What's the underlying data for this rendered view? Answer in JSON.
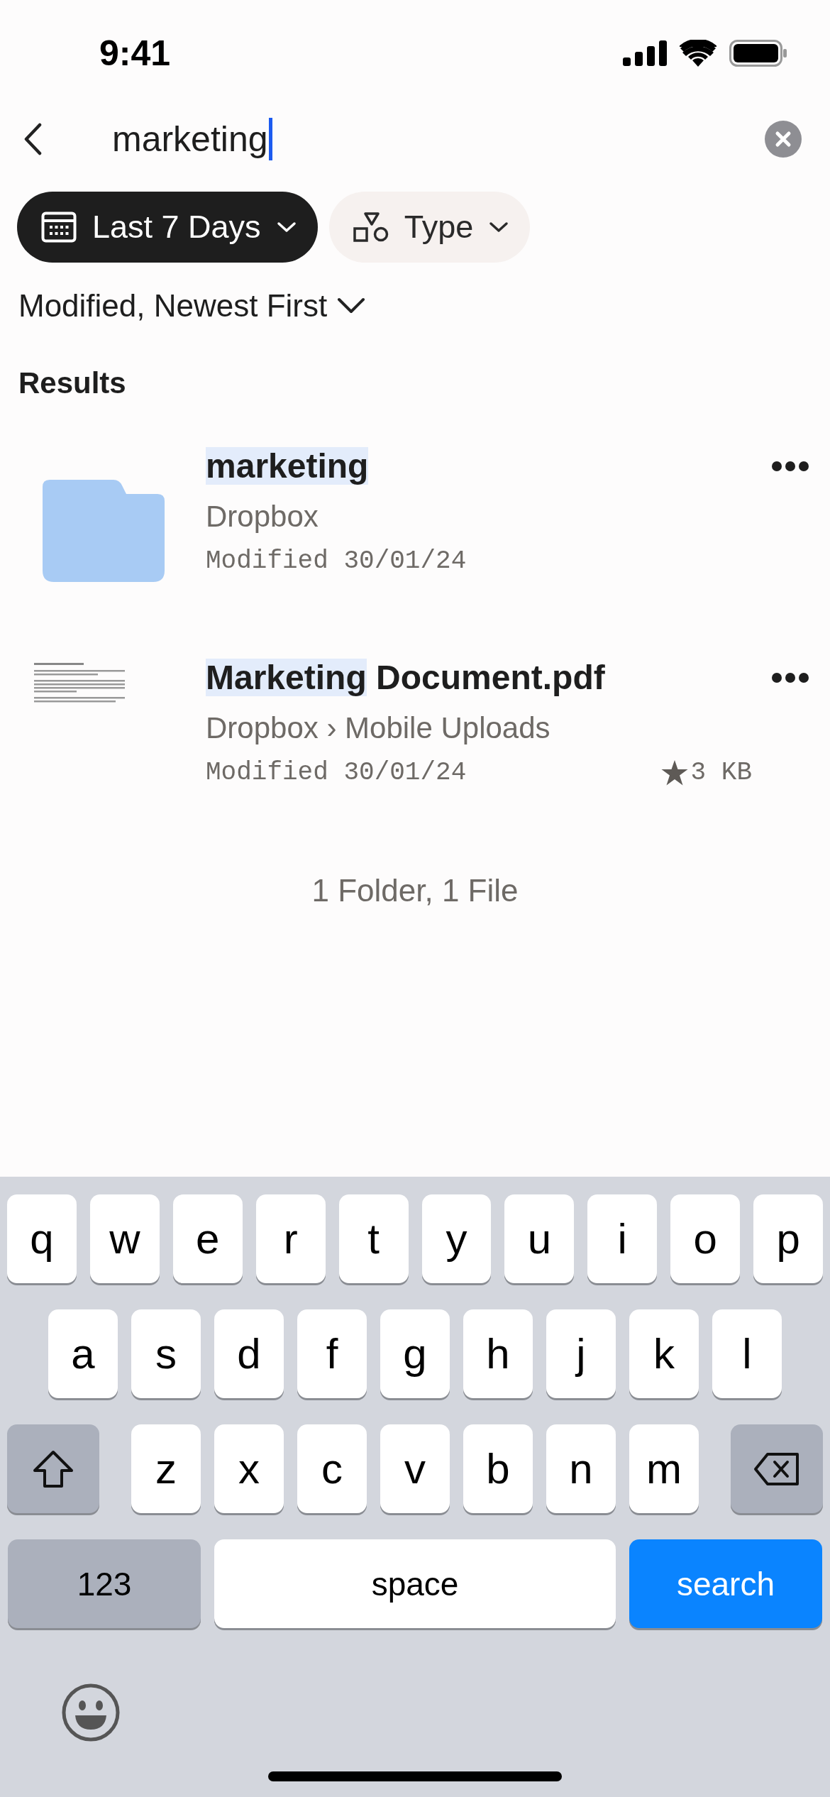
{
  "status_bar": {
    "time": "9:41"
  },
  "search": {
    "value": "marketing"
  },
  "filters": [
    {
      "label": "Last 7 Days",
      "kind": "date",
      "selected": true
    },
    {
      "label": "Type",
      "kind": "type",
      "selected": false
    }
  ],
  "sort": {
    "label": "Modified, Newest First"
  },
  "results_heading": "Results",
  "results": [
    {
      "kind": "folder",
      "match": "marketing",
      "location": "Dropbox",
      "modified": "Modified 30/01/24",
      "starred": false
    },
    {
      "kind": "pdf",
      "match": "Marketing",
      "rest": " Document.pdf",
      "location": "Dropbox › Mobile Uploads",
      "modified": "Modified 30/01/24",
      "starred": true,
      "size": "3 KB"
    }
  ],
  "summary": "1 Folder, 1 File",
  "keyboard": {
    "letter_rows": [
      [
        "q",
        "w",
        "e",
        "r",
        "t",
        "y",
        "u",
        "i",
        "o",
        "p"
      ],
      [
        "a",
        "s",
        "d",
        "f",
        "g",
        "h",
        "j",
        "k",
        "l"
      ],
      [
        "z",
        "x",
        "c",
        "v",
        "b",
        "n",
        "m"
      ]
    ],
    "mode_key": "123",
    "space_key": "space",
    "action_key": "search"
  }
}
